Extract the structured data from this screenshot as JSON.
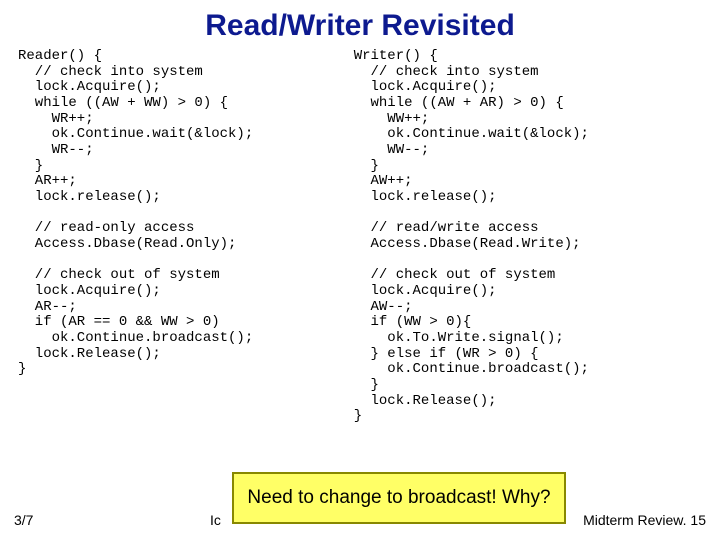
{
  "title": "Read/Writer Revisited",
  "reader_code": "Reader() {\n  // check into system\n  lock.Acquire();\n  while ((AW + WW) > 0) {\n    WR++;\n    ok.Continue.wait(&lock);\n    WR--;\n  }\n  AR++;\n  lock.release();\n\n  // read-only access\n  Access.Dbase(Read.Only);\n\n  // check out of system\n  lock.Acquire();\n  AR--;\n  if (AR == 0 && WW > 0)\n    ok.Continue.broadcast();\n  lock.Release();\n}",
  "writer_code": "Writer() {\n  // check into system\n  lock.Acquire();\n  while ((AW + AR) > 0) {\n    WW++;\n    ok.Continue.wait(&lock);\n    WW--;\n  }\n  AW++;\n  lock.release();\n\n  // read/write access\n  Access.Dbase(Read.Write);\n\n  // check out of system\n  lock.Acquire();\n  AW--;\n  if (WW > 0){\n    ok.To.Write.signal();\n  } else if (WR > 0) {\n    ok.Continue.broadcast();\n  }\n  lock.Release();\n}",
  "callout_text": "Need to change to broadcast! Why?",
  "footer": {
    "left": "3/7",
    "mid": "Ic",
    "right": "Midterm Review. 15"
  }
}
